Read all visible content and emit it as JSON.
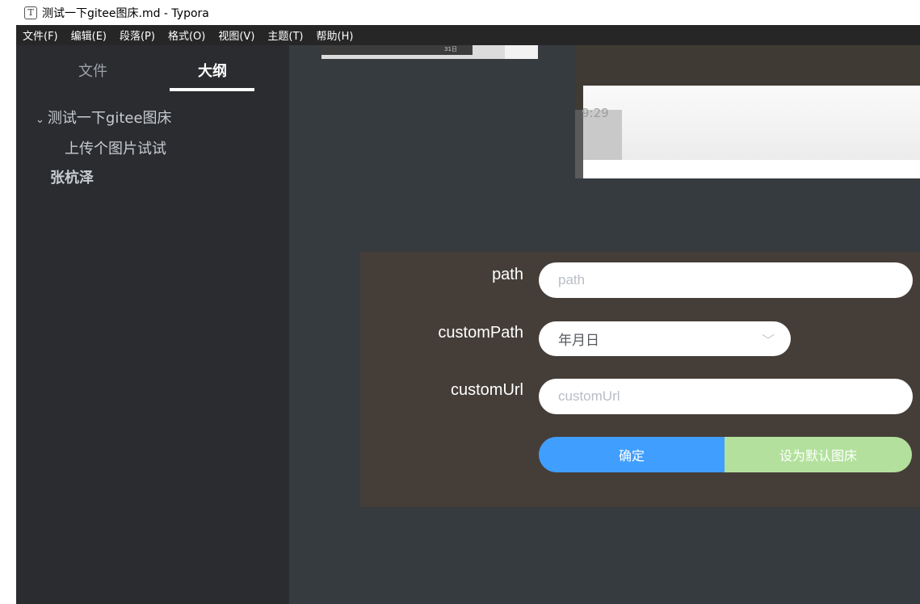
{
  "window": {
    "title": "测试一下gitee图床.md - Typora",
    "icon_name": "typora-app-icon",
    "icon_glyph": "T"
  },
  "menu": [
    {
      "label": "文件(F)"
    },
    {
      "label": "编辑(E)"
    },
    {
      "label": "段落(P)"
    },
    {
      "label": "格式(O)"
    },
    {
      "label": "视图(V)"
    },
    {
      "label": "主题(T)"
    },
    {
      "label": "帮助(H)"
    }
  ],
  "sidebar": {
    "tabs": {
      "files": "文件",
      "outline": "大纲"
    },
    "active_tab": "outline",
    "outline": [
      {
        "label": "测试一下gitee图床",
        "level": 1,
        "collapsible": true
      },
      {
        "label": "上传个图片试试",
        "level": 2
      },
      {
        "label": "张杭泽",
        "level": 1,
        "bold": true
      }
    ]
  },
  "editor": {
    "image_top": {
      "date_text": "31日"
    },
    "image_screenshot": {
      "time_text": "9:29"
    },
    "form": {
      "path_label": "path",
      "path_placeholder": "path",
      "custompath_label": "customPath",
      "custompath_value": "年月日",
      "customurl_label": "customUrl",
      "customurl_placeholder": "customUrl",
      "confirm_button": "确定",
      "default_button": "设为默认图床"
    }
  },
  "colors": {
    "menubar": "#262626",
    "sidebar": "#2b2c2f",
    "editor": "#363b40",
    "form_panel": "#453e38",
    "primary": "#409eff",
    "success_light": "#b3e19d"
  }
}
